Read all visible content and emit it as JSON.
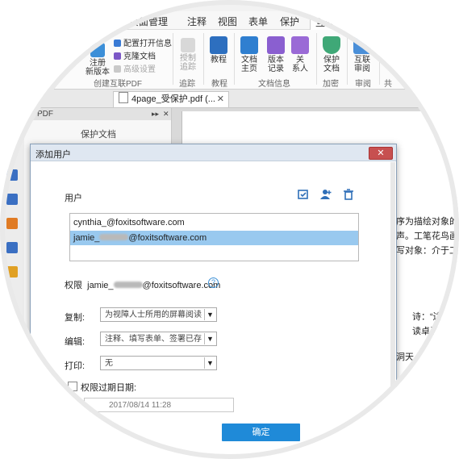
{
  "ribbon_tabs": [
    "页面管理",
    "注释",
    "视图",
    "表单",
    "保护",
    "互联"
  ],
  "ribbon": {
    "register_btn": "注册\n新版本",
    "config_open": "配置打开信息",
    "clone_doc": "克隆文档",
    "advanced": "高级设置",
    "group_create": "创建互联PDF",
    "tracking": "授制\n追踪",
    "group_tracking": "追踪",
    "tutorial": "教程",
    "group_tutorial": "教程",
    "doc_home": "文档\n主页",
    "version": "版本\n记录",
    "relations": "关\n系人",
    "group_docinfo": "文档信息",
    "protect_doc": "保护\n文档",
    "group_encrypt": "加密",
    "connected_review": "互联\n审阅",
    "group_review": "审阅",
    "group_share": "共"
  },
  "doc_tab": {
    "title": "4page_受保护.pdf (...",
    "close": "✕"
  },
  "left_panel": {
    "header": "PDF",
    "title": "保护文档",
    "pin": "▸▸",
    "close": "✕"
  },
  "doc_text": [
    "序为描绘对象的",
    "声。工笔花鸟画",
    "写对象：介于工",
    "诗：“边",
    "读卓吾",
    "洞天"
  ],
  "dialog": {
    "title": "添加用户",
    "close": "✕",
    "users_label": "用户",
    "users": [
      {
        "prefix": "cynthia_@foxitsoftware.com",
        "suffix": "",
        "blurred": false,
        "selected": false
      },
      {
        "prefix": "jamie_",
        "suffix": "@foxitsoftware.com",
        "blurred": true,
        "selected": true
      }
    ],
    "perm_label": "权限",
    "perm_user_prefix": "jamie_",
    "perm_user_suffix": "@foxitsoftware.com",
    "help": "?",
    "copy_label": "复制:",
    "copy_value": "为视障人士所用的屏幕阅读",
    "edit_label": "编辑:",
    "edit_value": "注释、填写表单、签署已存",
    "print_label": "打印:",
    "print_value": "无",
    "expire_label": "权限过期日期:",
    "expire_date": "2017/08/14 11:28",
    "ok": "确定"
  },
  "colors": {
    "accent": "#1f8ad8",
    "selection": "#99c9ef",
    "close": "#c75050"
  }
}
